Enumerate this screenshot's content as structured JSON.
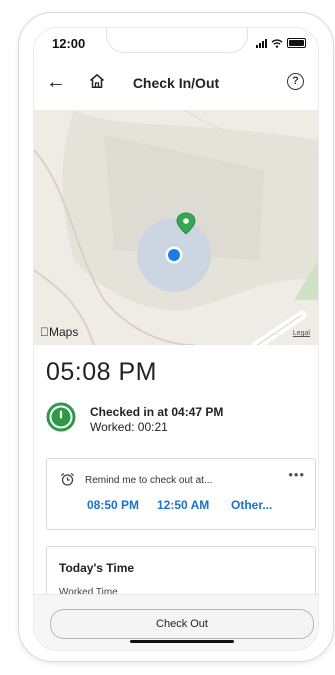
{
  "status_bar": {
    "time": "12:00"
  },
  "nav": {
    "title": "Check In/Out",
    "help_label": "?"
  },
  "map": {
    "maps_label": "Maps",
    "legal_label": "Legal"
  },
  "clock": {
    "time": "05:08 PM"
  },
  "checkin": {
    "title": "Checked in at 04:47 PM",
    "worked": "Worked: 00:21"
  },
  "reminder": {
    "text": "Remind me to check out at...",
    "options": [
      "08:50 PM",
      "12:50 AM",
      "Other..."
    ]
  },
  "today": {
    "title": "Today's Time",
    "subtitle": "Worked Time"
  },
  "footer": {
    "checkout_label": "Check Out"
  },
  "colors": {
    "accent": "#1a73c9",
    "checkin_green": "#2e9a47",
    "location_blue": "#1d7de6",
    "pin_green": "#34a853"
  },
  "icons": [
    "back-arrow-icon",
    "home-icon",
    "help-icon",
    "location-pin-icon",
    "user-location-icon",
    "checkin-status-icon",
    "alarm-clock-icon",
    "more-icon"
  ]
}
